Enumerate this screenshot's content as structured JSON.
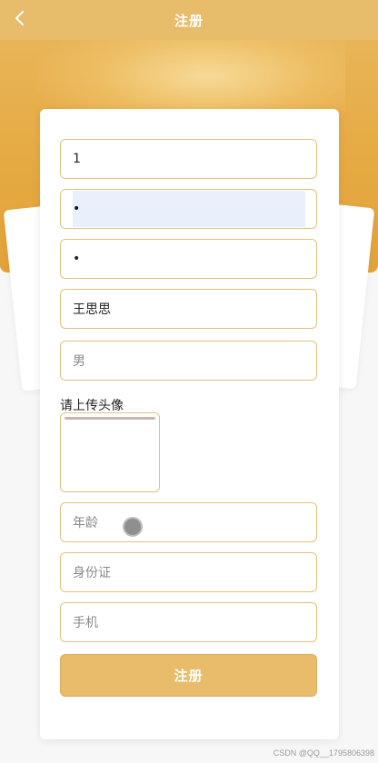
{
  "header": {
    "title": "注册",
    "back_icon": "chevron-left-icon"
  },
  "form": {
    "username": {
      "value": "1"
    },
    "password": {
      "value": "•"
    },
    "confirm_password": {
      "value": "•"
    },
    "name": {
      "value": "王思思"
    },
    "gender": {
      "placeholder": "男"
    },
    "avatar_label": "请上传头像",
    "age": {
      "placeholder": "年龄"
    },
    "id_card": {
      "placeholder": "身份证"
    },
    "phone": {
      "placeholder": "手机"
    },
    "submit_label": "注册"
  },
  "watermark": "CSDN @QQ__1795806398",
  "colors": {
    "brand": "#e6ab45",
    "topbar": "#e7bc6b",
    "field_border": "#e2c27c",
    "autofill_bg": "#e8f0fb",
    "button": "#e8bc6b"
  }
}
